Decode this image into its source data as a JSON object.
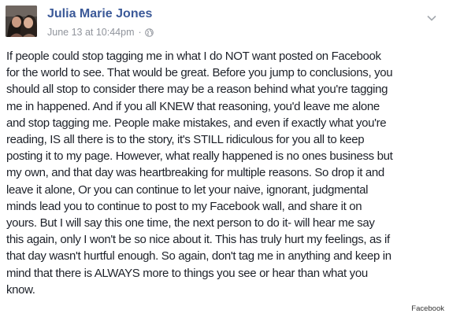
{
  "post": {
    "author": "Julia Marie Jones",
    "timestamp": "June 13 at 10:44pm",
    "separator": "·",
    "privacy_icon": "globe-icon",
    "menu_icon": "chevron-down-icon",
    "lines": [
      "If people could stop tagging me in what I do NOT want posted on Facebook",
      "for the world to see. That would be great. Before you jump to conclusions, you",
      "should all stop to consider there may be a reason behind what you're tagging",
      "me in happened. And if you all KNEW that reasoning, you'd leave me alone",
      "and stop tagging me. People make mistakes, and even if exactly what you're",
      "reading, IS all there is to the story, it's STILL ridiculous for you all to keep",
      "posting it to my page. However, what really happened is no ones business but",
      "my own, and that day was heartbreaking for multiple reasons. So drop it and",
      "leave it alone, Or you can continue to let your naive, ignorant, judgmental",
      "minds lead you to continue to post to my Facebook wall, and share it on",
      "yours. But I will say this one time, the next person to do it- will hear me say",
      "this again, only I won't be so nice about it. This has truly hurt my feelings, as if",
      "that day wasn't hurtful enough. So again, don't tag me in anything and keep in",
      "mind that there is ALWAYS more to things you see or hear than what you",
      "know."
    ]
  },
  "credit": "Facebook",
  "colors": {
    "author_link": "#3b5998",
    "meta_gray": "#90949c",
    "body_text": "#1d2129"
  }
}
